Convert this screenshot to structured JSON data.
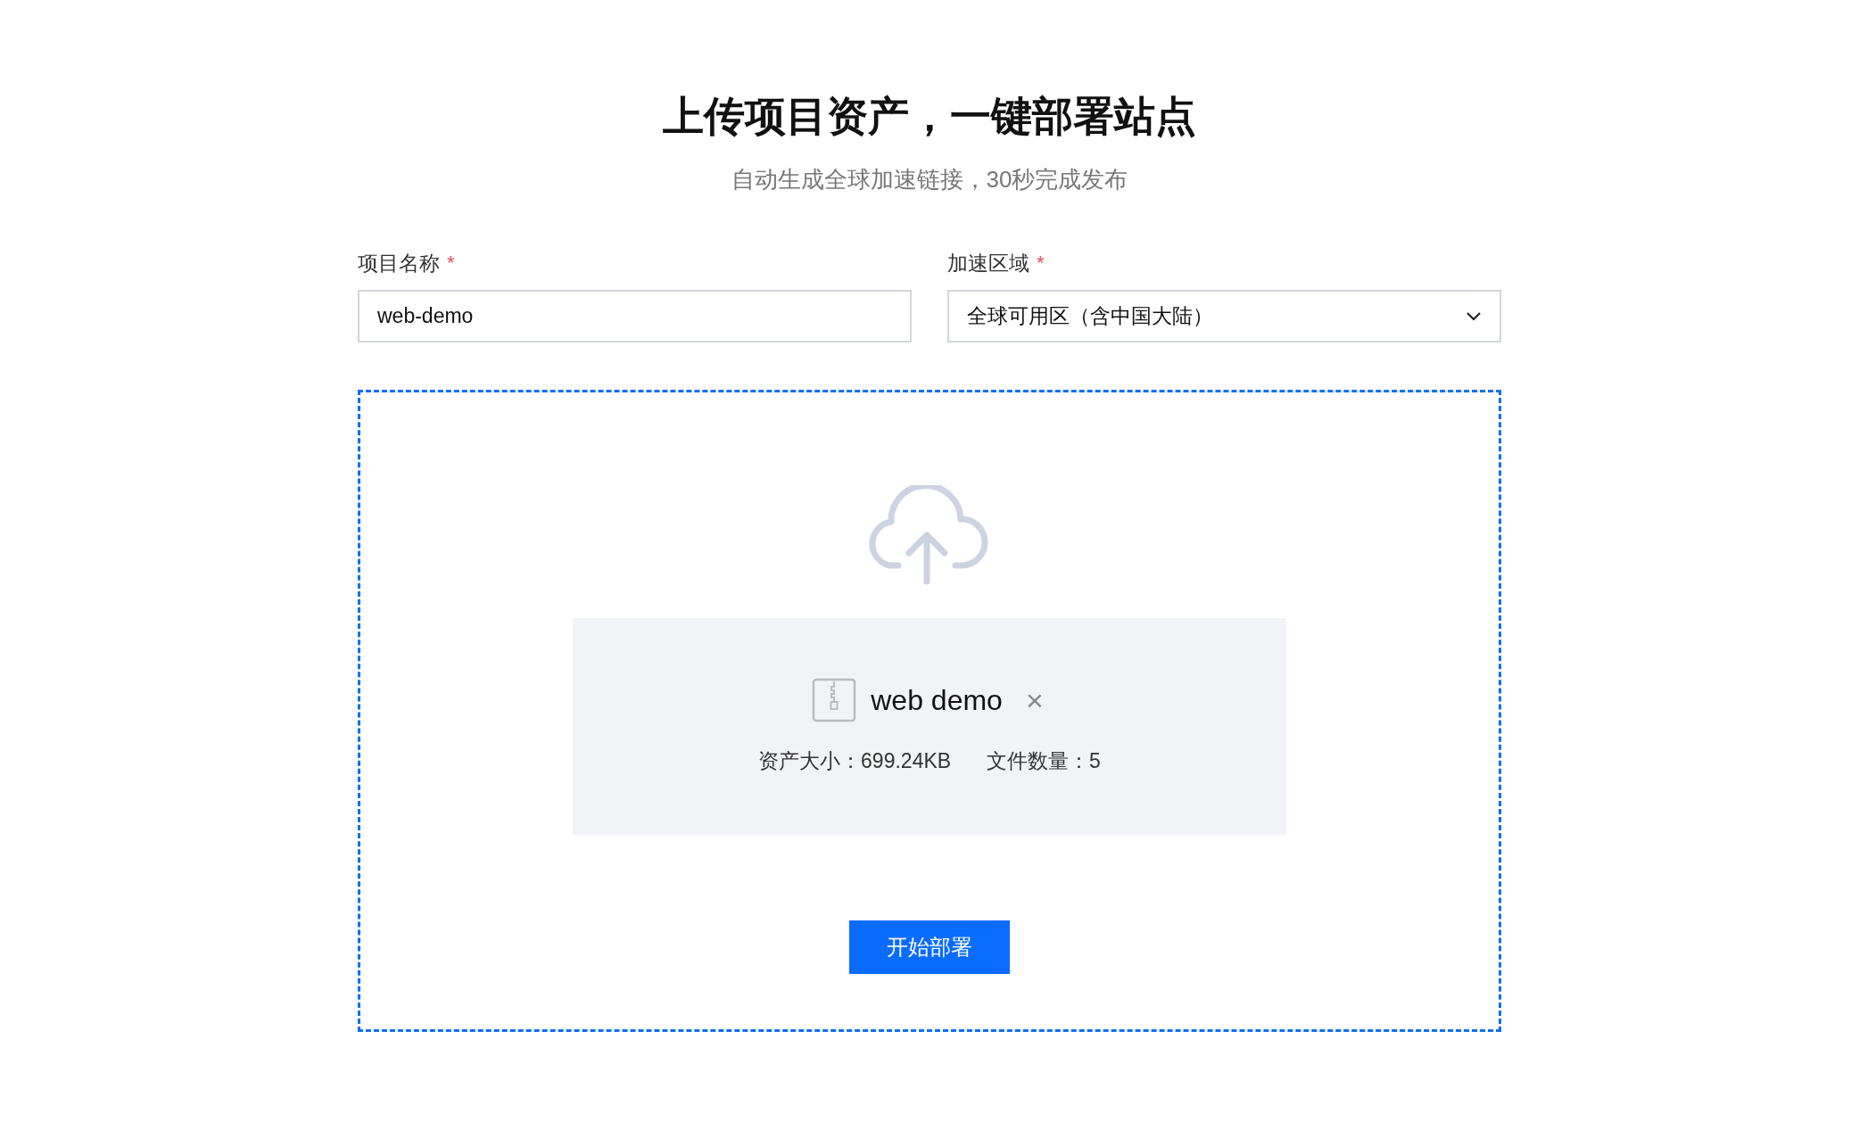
{
  "title": "上传项目资产，一键部署站点",
  "subtitle": "自动生成全球加速链接，30秒完成发布",
  "fields": [
    {
      "kind": "text",
      "label": "项目名称",
      "required_mark": "*",
      "value": "web-demo"
    },
    {
      "kind": "select",
      "label": "加速区域",
      "required_mark": "*",
      "value": "全球可用区（含中国大陆）"
    }
  ],
  "upload": {
    "file": {
      "name": "web demo",
      "remove": "×",
      "stats": [
        "资产大小：699.24KB",
        "文件数量：5"
      ]
    },
    "button": "开始部署"
  }
}
